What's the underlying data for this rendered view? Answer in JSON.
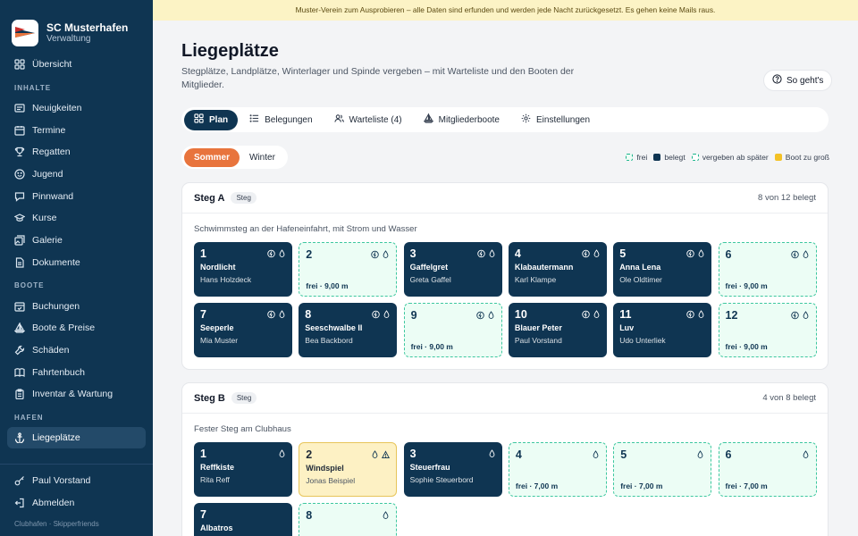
{
  "brand": {
    "name": "SC Musterhafen",
    "sub": "Verwaltung"
  },
  "sidebar": {
    "overview": "Übersicht",
    "sections": [
      {
        "title": "INHALTE",
        "items": [
          "Neuigkeiten",
          "Termine",
          "Regatten",
          "Jugend",
          "Pinnwand",
          "Kurse",
          "Galerie",
          "Dokumente"
        ]
      },
      {
        "title": "BOOTE",
        "items": [
          "Buchungen",
          "Boote & Preise",
          "Schäden",
          "Fahrtenbuch",
          "Inventar & Wartung"
        ]
      },
      {
        "title": "HAFEN",
        "items": [
          "Liegeplätze"
        ]
      }
    ],
    "user": "Paul Vorstand",
    "logout": "Abmelden",
    "footer": "Clubhafen · Skipperfriends"
  },
  "banner": "Muster-Verein zum Ausprobieren – alle Daten sind erfunden und werden jede Nacht zurückgesetzt. Es gehen keine Mails raus.",
  "page": {
    "title": "Liegeplätze",
    "desc": "Stegplätze, Landplätze, Winterlager und Spinde vergeben – mit Warteliste und den Booten der Mitglieder.",
    "help": "So geht's"
  },
  "tabs": [
    "Plan",
    "Belegungen",
    "Warteliste (4)",
    "Mitgliederboote",
    "Einstellungen"
  ],
  "seasons": [
    "Sommer",
    "Winter"
  ],
  "legend": {
    "frei": "frei",
    "belegt": "belegt",
    "spaeter": "vergeben ab später",
    "gross": "Boot zu groß"
  },
  "colors": {
    "navy": "#0f3552",
    "accent": "#e8743d",
    "free": "#3ec79f",
    "warn": "#f3c126"
  },
  "docks": [
    {
      "title": "Steg A",
      "badge": "Steg",
      "count": "8 von 12 belegt",
      "desc": "Schwimmsteg an der Hafeneinfahrt, mit Strom und Wasser",
      "slots": [
        {
          "num": "1",
          "status": "belegt",
          "name": "Nordlicht",
          "owner": "Hans Holzdeck",
          "icons": [
            "power",
            "water"
          ]
        },
        {
          "num": "2",
          "status": "frei",
          "free": "frei · 9,00 m",
          "icons": [
            "power",
            "water"
          ]
        },
        {
          "num": "3",
          "status": "belegt",
          "name": "Gaffelgret",
          "owner": "Greta Gaffel",
          "icons": [
            "power",
            "water"
          ]
        },
        {
          "num": "4",
          "status": "belegt",
          "name": "Klabautermann",
          "owner": "Karl Klampe",
          "icons": [
            "power",
            "water"
          ]
        },
        {
          "num": "5",
          "status": "belegt",
          "name": "Anna Lena",
          "owner": "Ole Oldtimer",
          "icons": [
            "power",
            "water"
          ]
        },
        {
          "num": "6",
          "status": "frei",
          "free": "frei · 9,00 m",
          "icons": [
            "power",
            "water"
          ]
        },
        {
          "num": "7",
          "status": "belegt",
          "name": "Seeperle",
          "owner": "Mia Muster",
          "icons": [
            "power",
            "water"
          ]
        },
        {
          "num": "8",
          "status": "belegt",
          "name": "Seeschwalbe II",
          "owner": "Bea Backbord",
          "icons": [
            "power",
            "water"
          ]
        },
        {
          "num": "9",
          "status": "frei",
          "free": "frei · 9,00 m",
          "icons": [
            "power",
            "water"
          ]
        },
        {
          "num": "10",
          "status": "belegt",
          "name": "Blauer Peter",
          "owner": "Paul Vorstand",
          "icons": [
            "power",
            "water"
          ]
        },
        {
          "num": "11",
          "status": "belegt",
          "name": "Luv",
          "owner": "Udo Unterliek",
          "icons": [
            "power",
            "water"
          ]
        },
        {
          "num": "12",
          "status": "frei",
          "free": "frei · 9,00 m",
          "icons": [
            "power",
            "water"
          ]
        }
      ]
    },
    {
      "title": "Steg B",
      "badge": "Steg",
      "count": "4 von 8 belegt",
      "desc": "Fester Steg am Clubhaus",
      "slots": [
        {
          "num": "1",
          "status": "belegt",
          "name": "Reffkiste",
          "owner": "Rita Reff",
          "icons": [
            "water"
          ]
        },
        {
          "num": "2",
          "status": "gross",
          "name": "Windspiel",
          "owner": "Jonas Beispiel",
          "icons": [
            "water",
            "warning"
          ]
        },
        {
          "num": "3",
          "status": "belegt",
          "name": "Steuerfrau",
          "owner": "Sophie Steuerbord",
          "icons": [
            "water"
          ]
        },
        {
          "num": "4",
          "status": "frei",
          "free": "frei · 7,00 m",
          "icons": [
            "water"
          ]
        },
        {
          "num": "5",
          "status": "frei",
          "free": "frei · 7,00 m",
          "icons": [
            "water"
          ]
        },
        {
          "num": "6",
          "status": "frei",
          "free": "frei · 7,00 m",
          "icons": [
            "water"
          ]
        },
        {
          "num": "7",
          "status": "belegt",
          "name": "Albatros",
          "owner": "",
          "icons": []
        },
        {
          "num": "8",
          "status": "frei",
          "free": "",
          "icons": [
            "water"
          ]
        }
      ]
    }
  ]
}
